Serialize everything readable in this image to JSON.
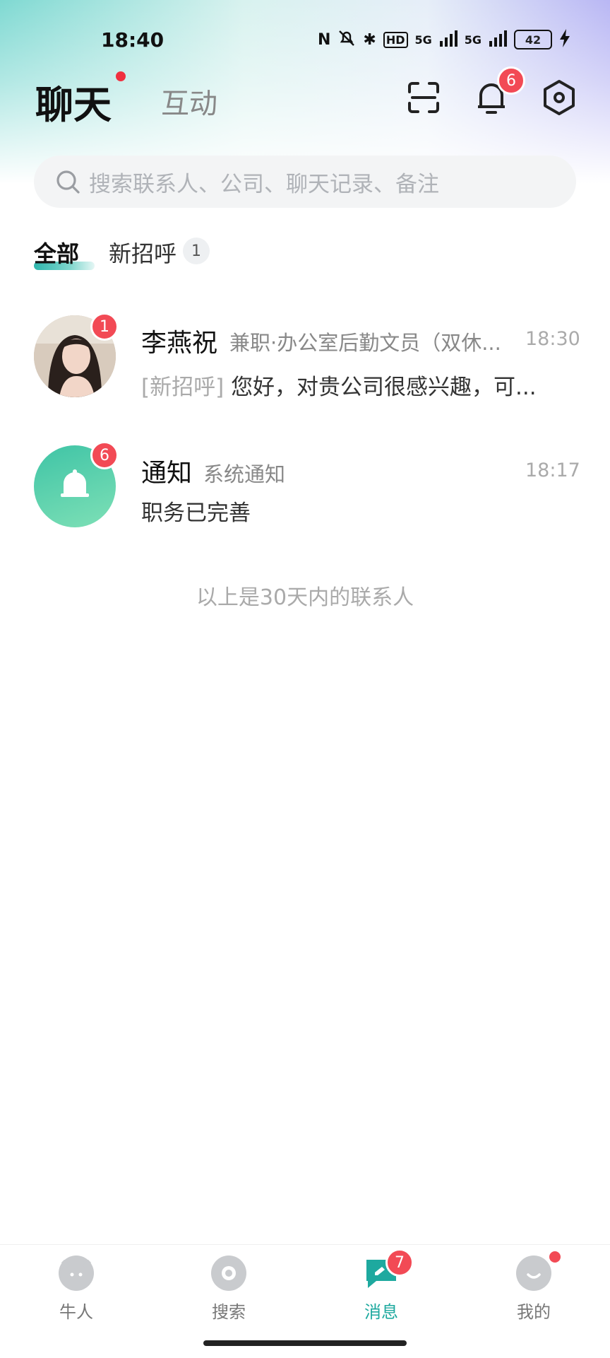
{
  "status_bar": {
    "time": "18:40",
    "nfc": "N",
    "bluetooth": "✱",
    "hd": "HD",
    "signal1": "5G",
    "signal2": "5G",
    "battery": "42"
  },
  "header": {
    "title": "聊天",
    "secondary_tab": "互动",
    "notification_count": "6"
  },
  "search": {
    "placeholder": "搜索联系人、公司、聊天记录、备注"
  },
  "tabs": {
    "all": "全部",
    "new_greetings": "新招呼",
    "new_greetings_count": "1"
  },
  "conversations": [
    {
      "name": "李燕祝",
      "subtitle": "兼职·办公室后勤文员（双休...",
      "time": "18:30",
      "tag": "[新招呼]",
      "preview": "您好，对贵公司很感兴趣，可...",
      "unread": "1"
    },
    {
      "name": "通知",
      "subtitle": "系统通知",
      "time": "18:17",
      "preview": "职务已完善",
      "unread": "6"
    }
  ],
  "footer_note": "以上是30天内的联系人",
  "bottom_nav": {
    "items": [
      {
        "label": "牛人",
        "icon": "cow-icon"
      },
      {
        "label": "搜索",
        "icon": "search-disc-icon"
      },
      {
        "label": "消息",
        "icon": "message-icon",
        "badge": "7",
        "active": true
      },
      {
        "label": "我的",
        "icon": "profile-icon"
      }
    ]
  },
  "colors": {
    "accent": "#1ea99f",
    "badge": "#f24a55"
  }
}
